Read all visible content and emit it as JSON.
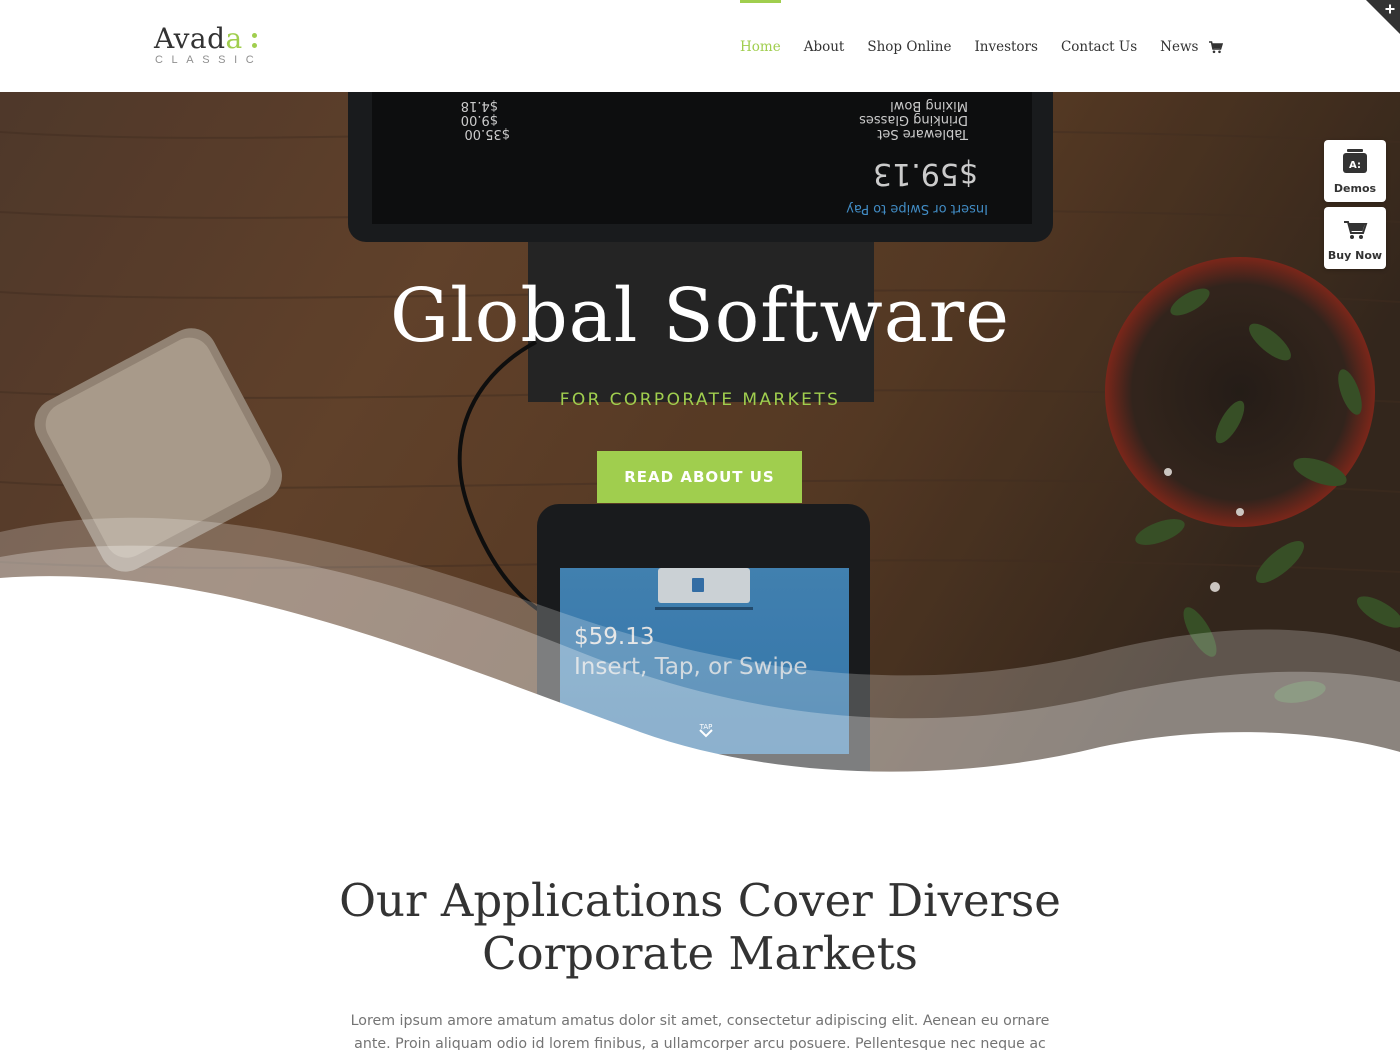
{
  "brand": {
    "logo_main": "Avad",
    "logo_accent": "a",
    "logo_sub": "CLASSIC",
    "accent_color": "#a0ce4e"
  },
  "nav": {
    "items": [
      {
        "label": "Home",
        "active": true
      },
      {
        "label": "About",
        "active": false
      },
      {
        "label": "Shop Online",
        "active": false
      },
      {
        "label": "Investors",
        "active": false
      },
      {
        "label": "Contact Us",
        "active": false
      },
      {
        "label": "News",
        "active": false
      }
    ],
    "cart_icon": "shopping-cart-icon"
  },
  "hero": {
    "title": "Global Software",
    "subtitle": "FOR CORPORATE MARKETS",
    "button_label": "READ ABOUT US",
    "scroll_icon": "chevron-down-icon",
    "terminal_top": {
      "amount": "$59.13",
      "prompt": "Insert or Swipe to Pay",
      "items": [
        "Tableware Set",
        "Drinking Glasses",
        "Mixing Bowl"
      ],
      "prices": [
        "$35.00",
        "$9.00",
        "$4.18"
      ]
    },
    "terminal_bottom": {
      "amount": "$59.13",
      "prompt": "Insert, Tap, or Swipe",
      "tap_label": "TAP"
    }
  },
  "side_widgets": {
    "demos_label": "Demos",
    "demos_badge": "A:",
    "buy_label": "Buy Now"
  },
  "corner_toggle_icon": "plus-icon",
  "content": {
    "title": "Our Applications Cover Diverse Corporate Markets",
    "text": "Lorem ipsum amore amatum amatus dolor sit amet, consectetur adipiscing elit. Aenean eu ornare ante. Proin aliquam odio id lorem finibus, a ullamcorper arcu posuere. Pellentesque nec neque ac lorem"
  }
}
